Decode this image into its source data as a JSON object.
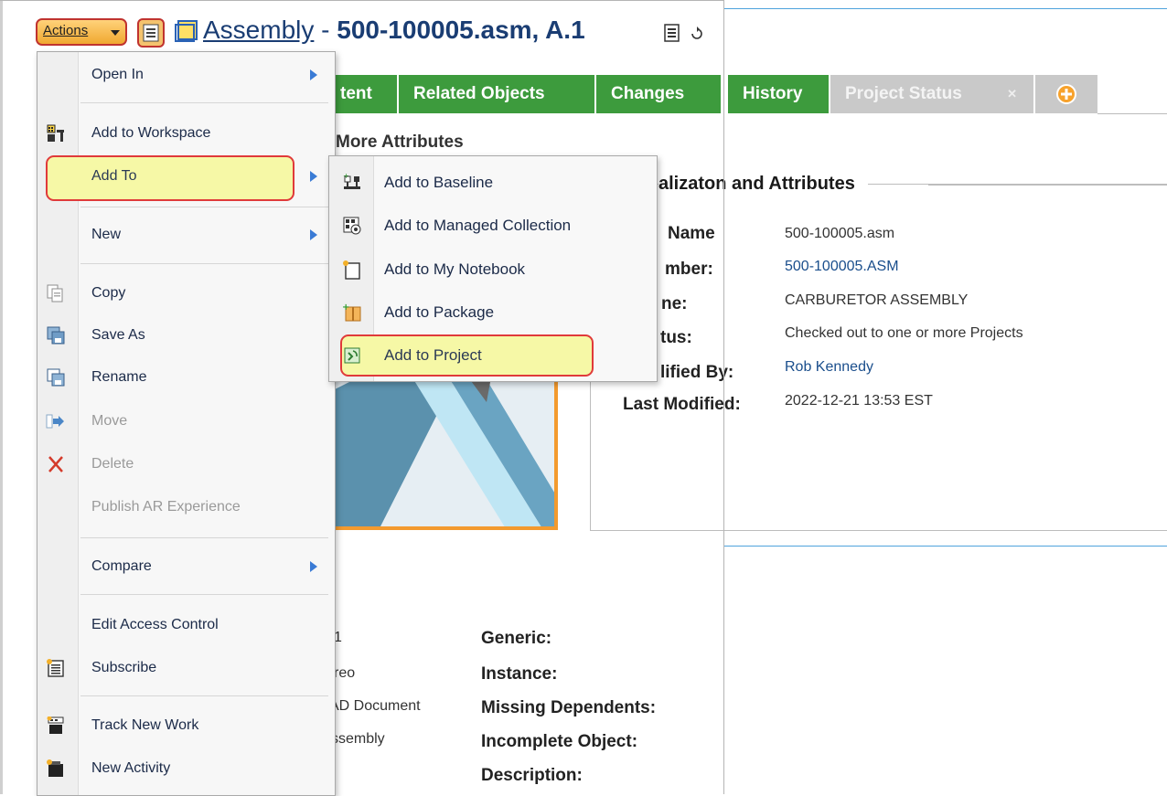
{
  "header": {
    "actions_label": "Actions",
    "object_type": "Assembly",
    "separator": " - ",
    "object_id": "500-100005.asm, A.1"
  },
  "tabs": [
    {
      "label": "tent",
      "style": "green"
    },
    {
      "label": "Related Objects",
      "style": "green"
    },
    {
      "label": "Changes",
      "style": "green"
    },
    {
      "label": "History",
      "style": "green"
    },
    {
      "label": "Project Status",
      "style": "grey"
    }
  ],
  "more_attributes": "More Attributes",
  "section_title": "alizaton and Attributes",
  "attributes": [
    {
      "label": "Name",
      "value": "500-100005.asm",
      "link": false
    },
    {
      "label": "mber:",
      "value": "500-100005.ASM",
      "link": true
    },
    {
      "label": "ne:",
      "value": "CARBURETOR ASSEMBLY",
      "link": false
    },
    {
      "label": "tus:",
      "value": "Checked out to one or more Projects",
      "link": false
    },
    {
      "label": "lified By:",
      "value": "Rob Kennedy",
      "link": true
    },
    {
      "label": "Last Modified:",
      "value": "2022-12-21 13:53 EST",
      "link": false
    }
  ],
  "lower_values": [
    "1",
    "reo",
    "AD Document",
    "ssembly"
  ],
  "lower_labels": [
    "Generic:",
    "Instance:",
    "Missing Dependents:",
    "Incomplete Object:",
    "Description:"
  ],
  "actions_menu": [
    {
      "label": "Open In",
      "icon": "none",
      "submenu": true,
      "disabled": false
    },
    {
      "label": "Add to Workspace",
      "icon": "workspace-icon",
      "submenu": false,
      "disabled": false
    },
    {
      "label": "Add To",
      "icon": "none",
      "submenu": true,
      "disabled": false,
      "highlighted": true
    },
    {
      "label": "New",
      "icon": "none",
      "submenu": true,
      "disabled": false
    },
    {
      "label": "Copy",
      "icon": "copy-icon",
      "submenu": false,
      "disabled": false
    },
    {
      "label": "Save As",
      "icon": "save-as-icon",
      "submenu": false,
      "disabled": false
    },
    {
      "label": "Rename",
      "icon": "rename-icon",
      "submenu": false,
      "disabled": false
    },
    {
      "label": "Move",
      "icon": "move-icon",
      "submenu": false,
      "disabled": true
    },
    {
      "label": "Delete",
      "icon": "delete-icon",
      "submenu": false,
      "disabled": true
    },
    {
      "label": "Publish AR Experience",
      "icon": "none",
      "submenu": false,
      "disabled": true
    },
    {
      "label": "Compare",
      "icon": "none",
      "submenu": true,
      "disabled": false
    },
    {
      "label": "Edit Access Control",
      "icon": "none",
      "submenu": false,
      "disabled": false
    },
    {
      "label": "Subscribe",
      "icon": "subscribe-icon",
      "submenu": false,
      "disabled": false
    },
    {
      "label": "Track New Work",
      "icon": "track-work-icon",
      "submenu": false,
      "disabled": false
    },
    {
      "label": "New Activity",
      "icon": "new-activity-icon",
      "submenu": false,
      "disabled": false
    }
  ],
  "add_to_submenu": [
    {
      "label": "Add to Baseline",
      "icon": "baseline-icon"
    },
    {
      "label": "Add to Managed Collection",
      "icon": "managed-collection-icon"
    },
    {
      "label": "Add to My Notebook",
      "icon": "notebook-icon"
    },
    {
      "label": "Add to Package",
      "icon": "package-icon"
    },
    {
      "label": "Add to Project",
      "icon": "project-icon",
      "highlighted": true
    }
  ],
  "colors": {
    "tab_green": "#3d9b3d",
    "tab_grey": "#c9c9c9",
    "highlight_fill": "#f6f8a6",
    "highlight_border": "#e03a3a",
    "actions_button": "#f0a830"
  }
}
